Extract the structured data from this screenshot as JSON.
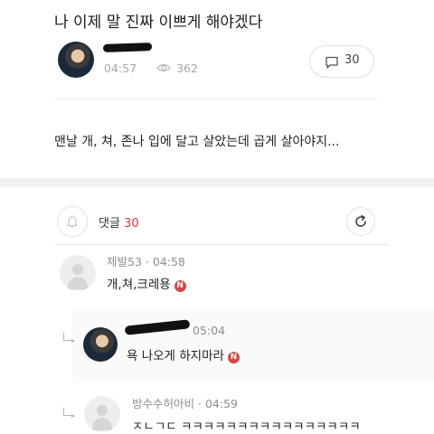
{
  "post": {
    "title": "나 이제 말 진짜 이쁘게 해야겠다",
    "time": "04:57",
    "views": "362",
    "comment_count": "30",
    "body": "맨날 개, 쳐, 존나 입에 달고 살았는데 곱게 살아야지..."
  },
  "comments_header": {
    "label": "댓글",
    "count": "30"
  },
  "comments": [
    {
      "author": "제발53",
      "time": "04:58",
      "text": "개,쳐,크레용",
      "badge": "N"
    },
    {
      "author": "",
      "time": "05:04",
      "text": "욕 나오게 하지마라",
      "badge": "N"
    },
    {
      "author": "방수수허아비",
      "time": "04:59",
      "text": "ㅈㄴㄱㄷ ㅋㅋㅋㅋㅋㅋㅋㅋㅋㅋㅋㅋㅋㅋㅋㅋ"
    }
  ],
  "icons": {
    "views": "eye-icon",
    "comments": "speech-bubble-icon",
    "notify": "bell-icon",
    "refresh": "refresh-icon",
    "new_badge": "new-badge-icon"
  },
  "colors": {
    "accent": "#e2313c",
    "badge": "#d64545",
    "muted": "#a8a8a8"
  }
}
